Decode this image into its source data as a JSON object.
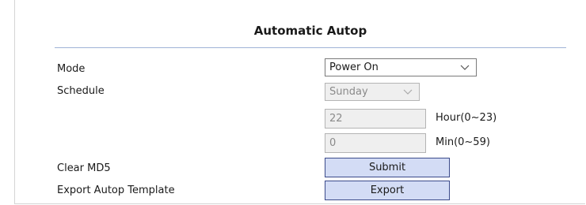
{
  "section": {
    "title": "Automatic Autop"
  },
  "mode": {
    "label": "Mode",
    "value": "Power On"
  },
  "schedule": {
    "label": "Schedule",
    "value": "Sunday",
    "hour_value": "22",
    "hour_unit": "Hour(0~23)",
    "min_value": "0",
    "min_unit": "Min(0~59)"
  },
  "clear_md5": {
    "label": "Clear MD5",
    "button": "Submit"
  },
  "export_template": {
    "label": "Export Autop Template",
    "button": "Export"
  },
  "icons": {
    "dropdown": "chevron-down-icon"
  },
  "colors": {
    "button_fill": "#d3dcf5",
    "button_border": "#3b4a8a",
    "title_rule": "#9fb3d6",
    "disabled_fill": "#efefef"
  }
}
